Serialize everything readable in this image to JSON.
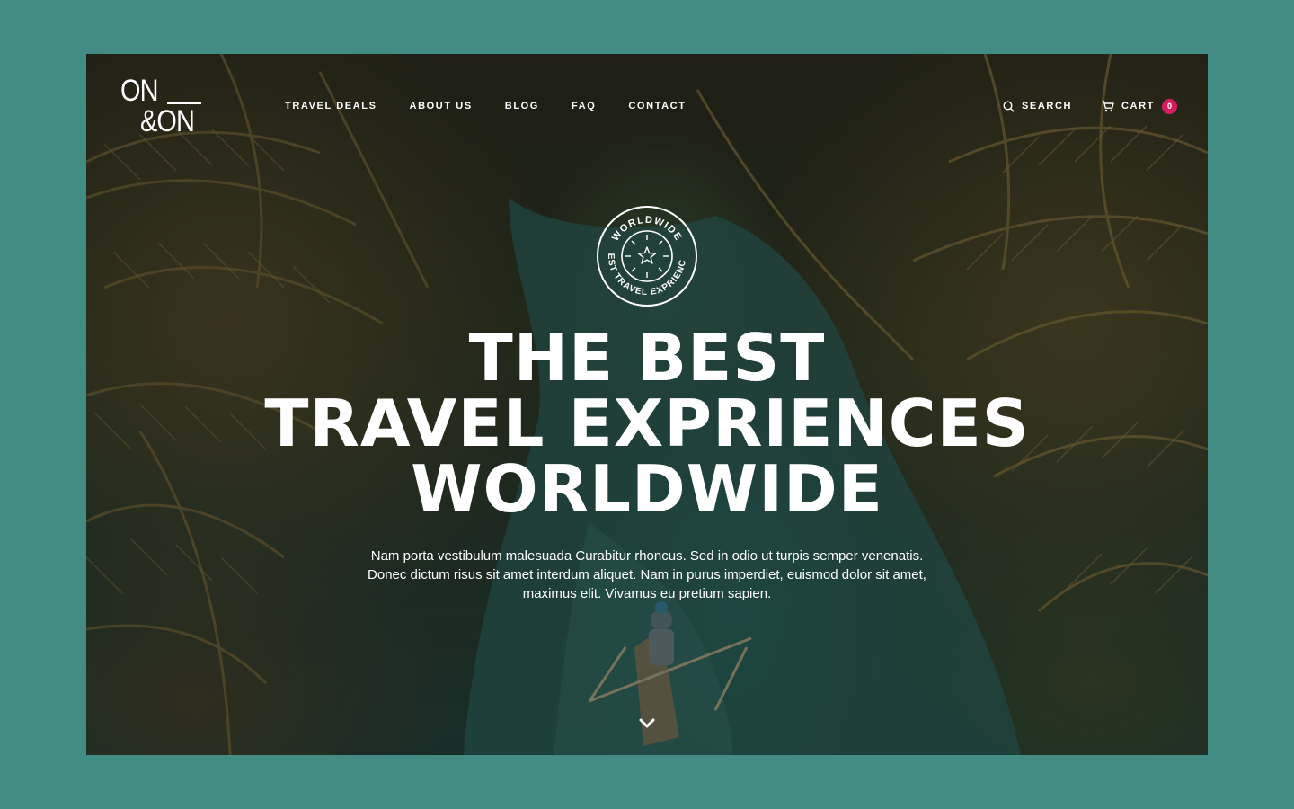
{
  "brand": {
    "logo_line1": "ON",
    "logo_line2": "&ON"
  },
  "nav": {
    "items": [
      {
        "label": "TRAVEL DEALS"
      },
      {
        "label": "ABOUT US"
      },
      {
        "label": "BLOG"
      },
      {
        "label": "FAQ"
      },
      {
        "label": "CONTACT"
      }
    ]
  },
  "header_actions": {
    "search_label": "SEARCH",
    "cart_label": "CART",
    "cart_count": "0",
    "search_icon": "search-icon",
    "cart_icon": "cart-icon"
  },
  "seal": {
    "top_text": "WORLDWIDE",
    "bottom_text": "BEST TRAVEL EXPRIENCES",
    "icon": "star-icon"
  },
  "hero": {
    "headline_line1": "THE BEST",
    "headline_line2": "TRAVEL EXPRIENCES",
    "headline_line3": "WORLDWIDE",
    "description": "Nam porta vestibulum malesuada Curabitur rhoncus. Sed in odio ut turpis semper venenatis. Donec dictum risus sit amet interdum aliquet. Nam in purus imperdiet, euismod dolor sit amet, maximus elit. Vivamus eu pretium sapien.",
    "scroll_icon": "chevron-down-icon"
  },
  "colors": {
    "page_background": "#428c84",
    "badge": "#d81b60",
    "text": "#ffffff"
  }
}
